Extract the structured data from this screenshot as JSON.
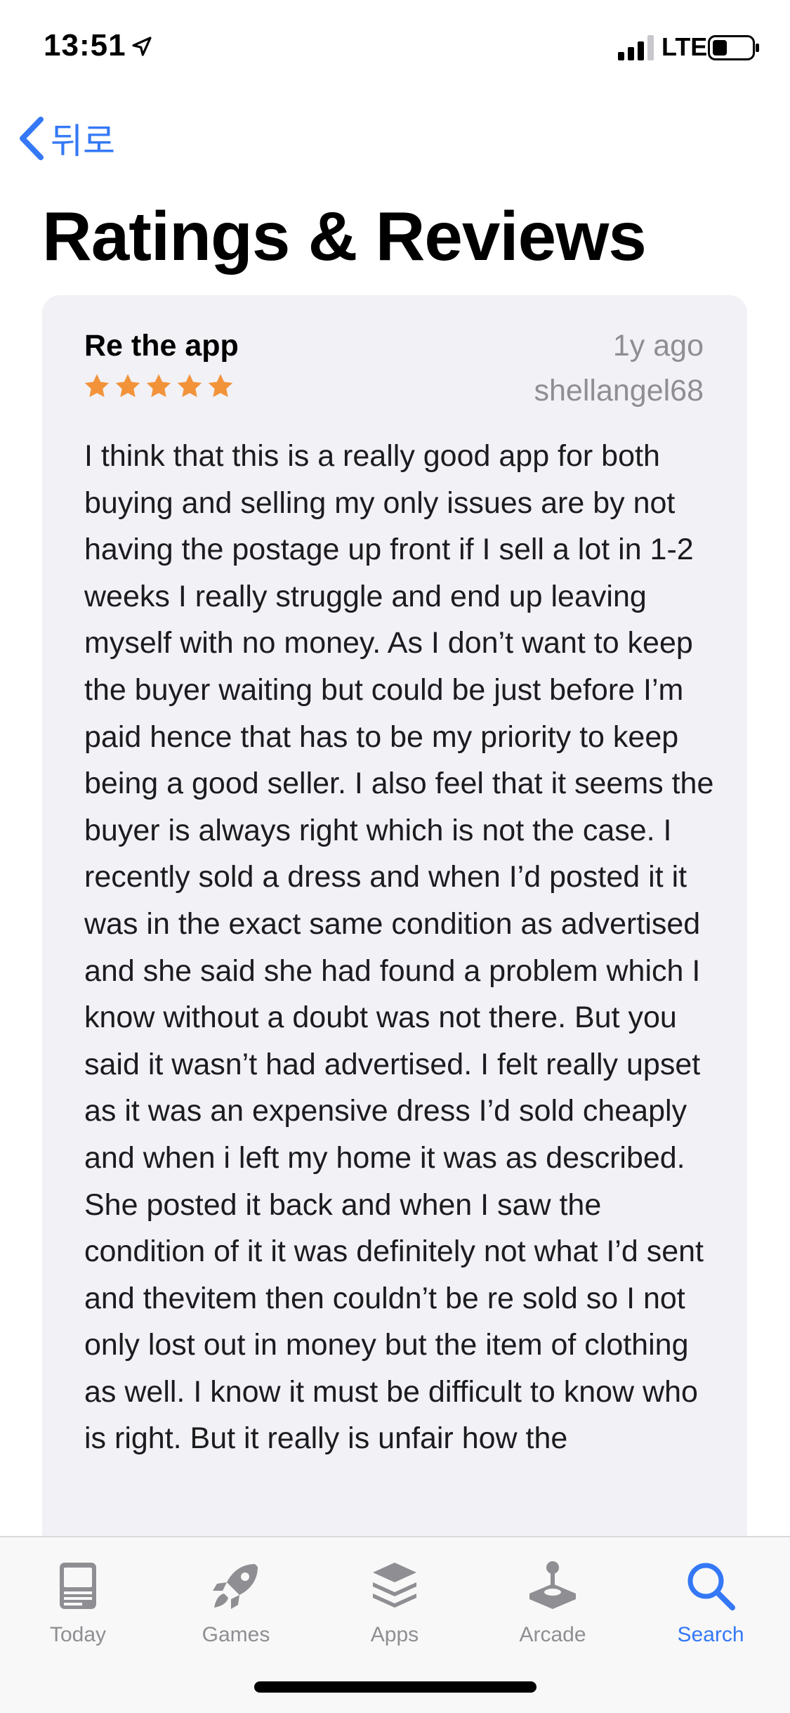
{
  "status_bar": {
    "time": "13:51",
    "network": "LTE"
  },
  "nav": {
    "back_label": "뒤로"
  },
  "page": {
    "title": "Ratings & Reviews"
  },
  "review": {
    "title": "Re the app",
    "date": "1y ago",
    "author": "shellangel68",
    "rating": 5,
    "rating_max": 5,
    "star_color": "#f2933a",
    "body": "I think that this is a really good app for both buying and selling my only issues are by not having the postage up front if I sell a lot in 1-2 weeks I really struggle and end up leaving myself with no money. As I don’t want to keep the buyer waiting but could be just before I’m paid hence that has to be my priority to keep being a good seller. I also feel that it seems the buyer is always right which is not the case. I recently sold a dress and when I’d posted it it was in the exact same condition as advertised and she said she had found a problem which I know without a doubt was not there. But you said it wasn’t had advertised. I felt really upset as it was an expensive dress I’d sold cheaply and when i left my home it was as described. She posted it back and when I saw the condition of it it was definitely not what I’d sent and thevitem then couldn’t be re sold so I not only lost out in money but the item of clothing as well. I know it must be difficult to know who is right. But it really is unfair how the"
  },
  "tab_bar": {
    "tabs": [
      {
        "label": "Today",
        "icon": "today-icon",
        "active": false
      },
      {
        "label": "Games",
        "icon": "rocket-icon",
        "active": false
      },
      {
        "label": "Apps",
        "icon": "apps-stack-icon",
        "active": false
      },
      {
        "label": "Arcade",
        "icon": "joystick-icon",
        "active": false
      },
      {
        "label": "Search",
        "icon": "search-icon",
        "active": true
      }
    ]
  },
  "colors": {
    "accent": "#3478f6",
    "inactive": "#8e8e93",
    "card_bg": "#f1f1f6"
  }
}
